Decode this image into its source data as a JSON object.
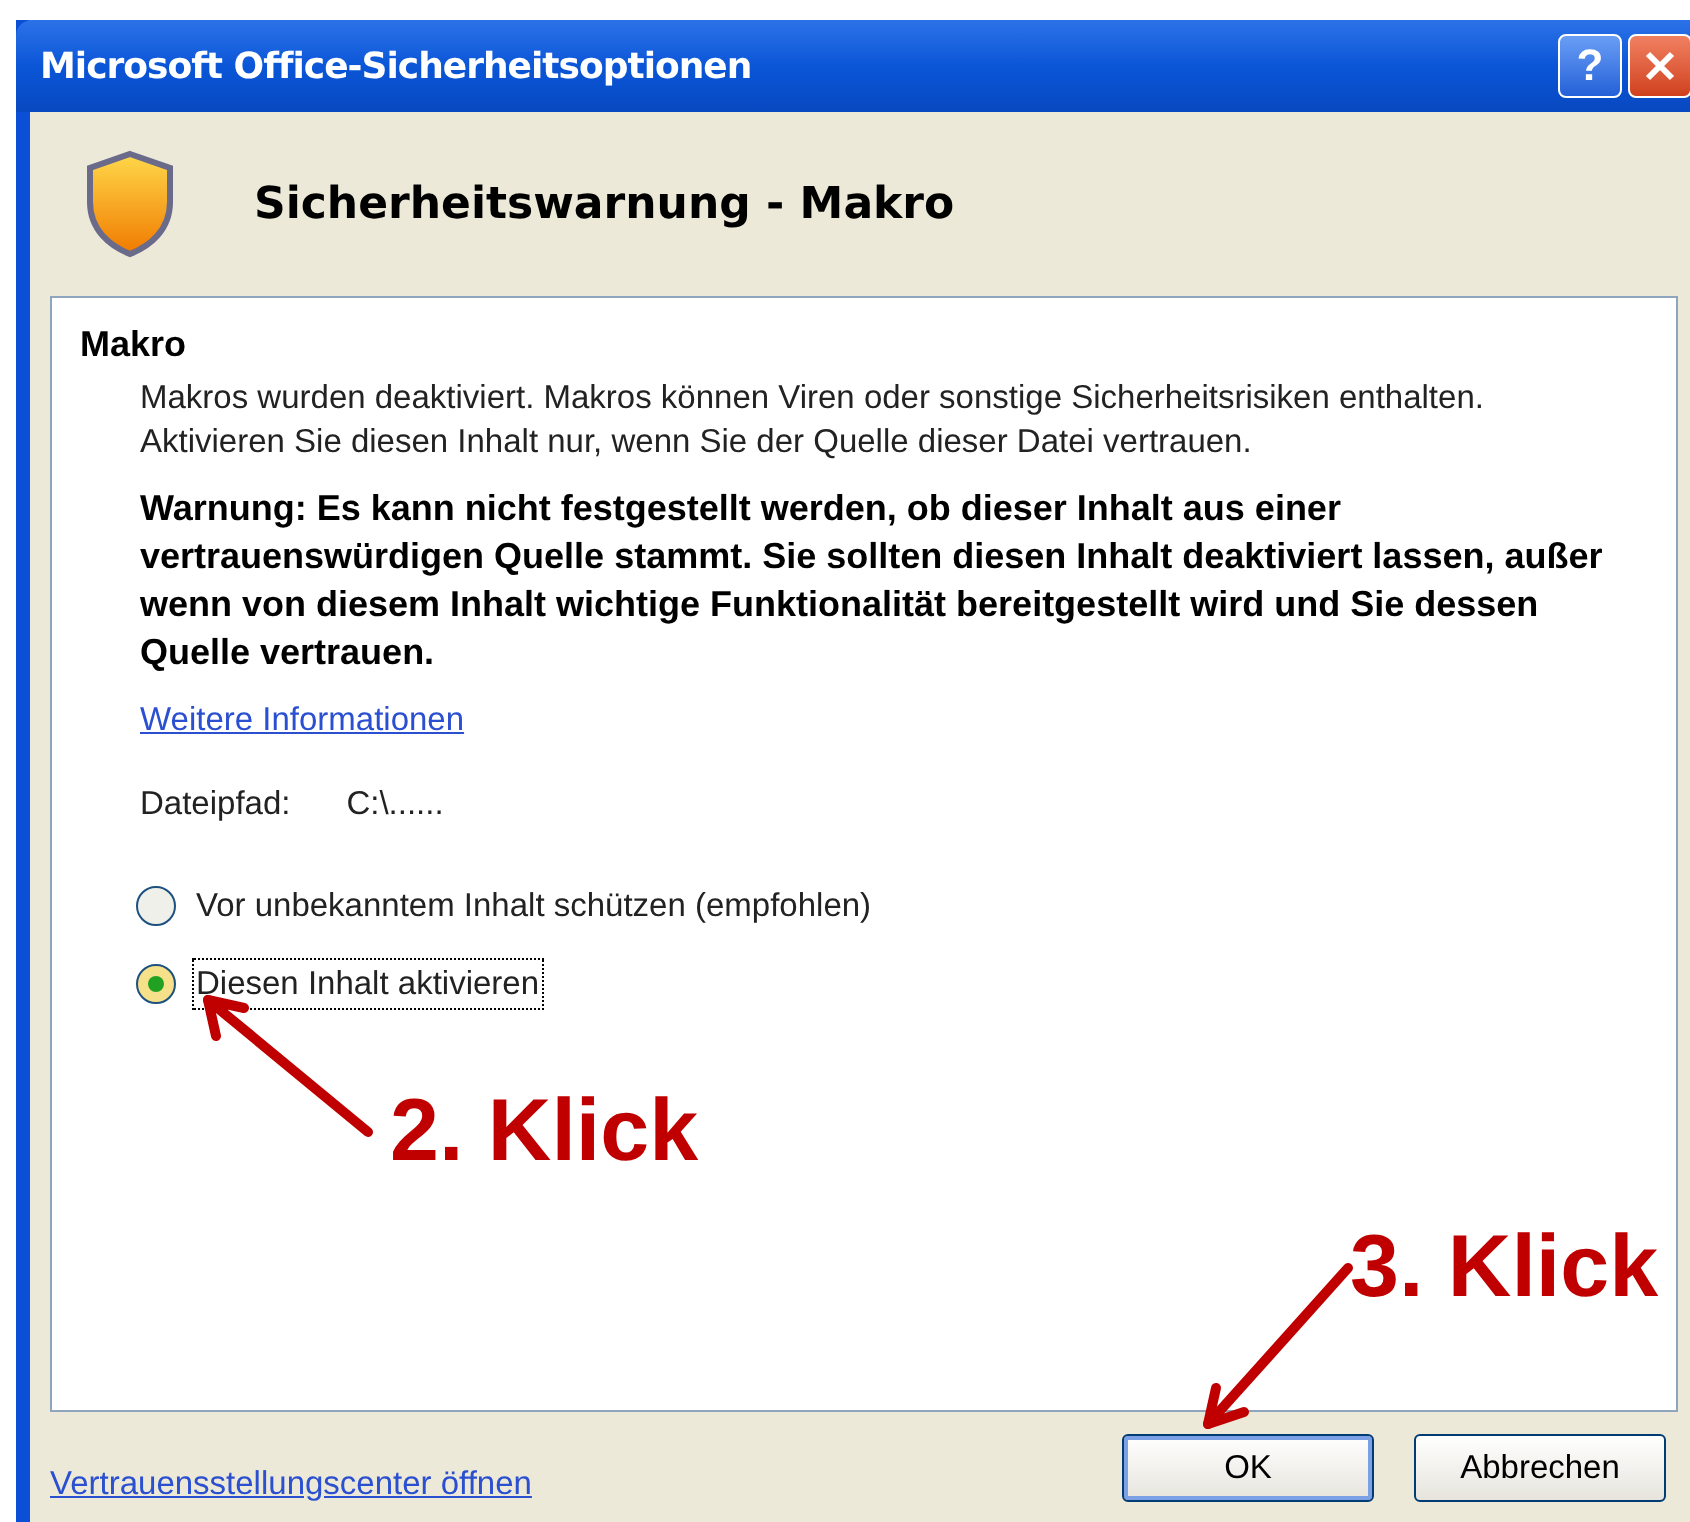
{
  "window": {
    "title": "Microsoft Office-Sicherheitsoptionen"
  },
  "title_buttons": [
    {
      "kind": "help",
      "label": "?"
    },
    {
      "kind": "close"
    }
  ],
  "header": {
    "title": "Sicherheitswarnung - Makro"
  },
  "panel": {
    "heading": "Makro",
    "description": "Makros wurden deaktiviert. Makros können Viren oder sonstige Sicherheitsrisiken enthalten. Aktivieren Sie diesen Inhalt nur, wenn Sie der Quelle dieser Datei vertrauen.",
    "warning": "Warnung: Es kann nicht festgestellt werden, ob dieser Inhalt aus einer vertrauenswürdigen Quelle stammt. Sie sollten diesen Inhalt deaktiviert lassen, außer wenn von diesem Inhalt wichtige Funktionalität bereitgestellt wird und Sie dessen Quelle vertrauen.",
    "link": "Weitere Informationen",
    "file_path": {
      "label": "Dateipfad:",
      "value": "C:\\......"
    },
    "options": [
      {
        "label": "Vor unbekanntem Inhalt schützen (empfohlen)",
        "selected": false
      },
      {
        "label": "Diesen Inhalt aktivieren",
        "selected": true
      }
    ]
  },
  "footer_link": "Vertrauensstellungscenter öffnen",
  "buttons": [
    {
      "label": "OK",
      "default": true
    },
    {
      "label": "Abbrechen",
      "default": false
    }
  ],
  "annotations": [
    {
      "text": "2. Klick"
    },
    {
      "text": "3. Klick"
    }
  ]
}
